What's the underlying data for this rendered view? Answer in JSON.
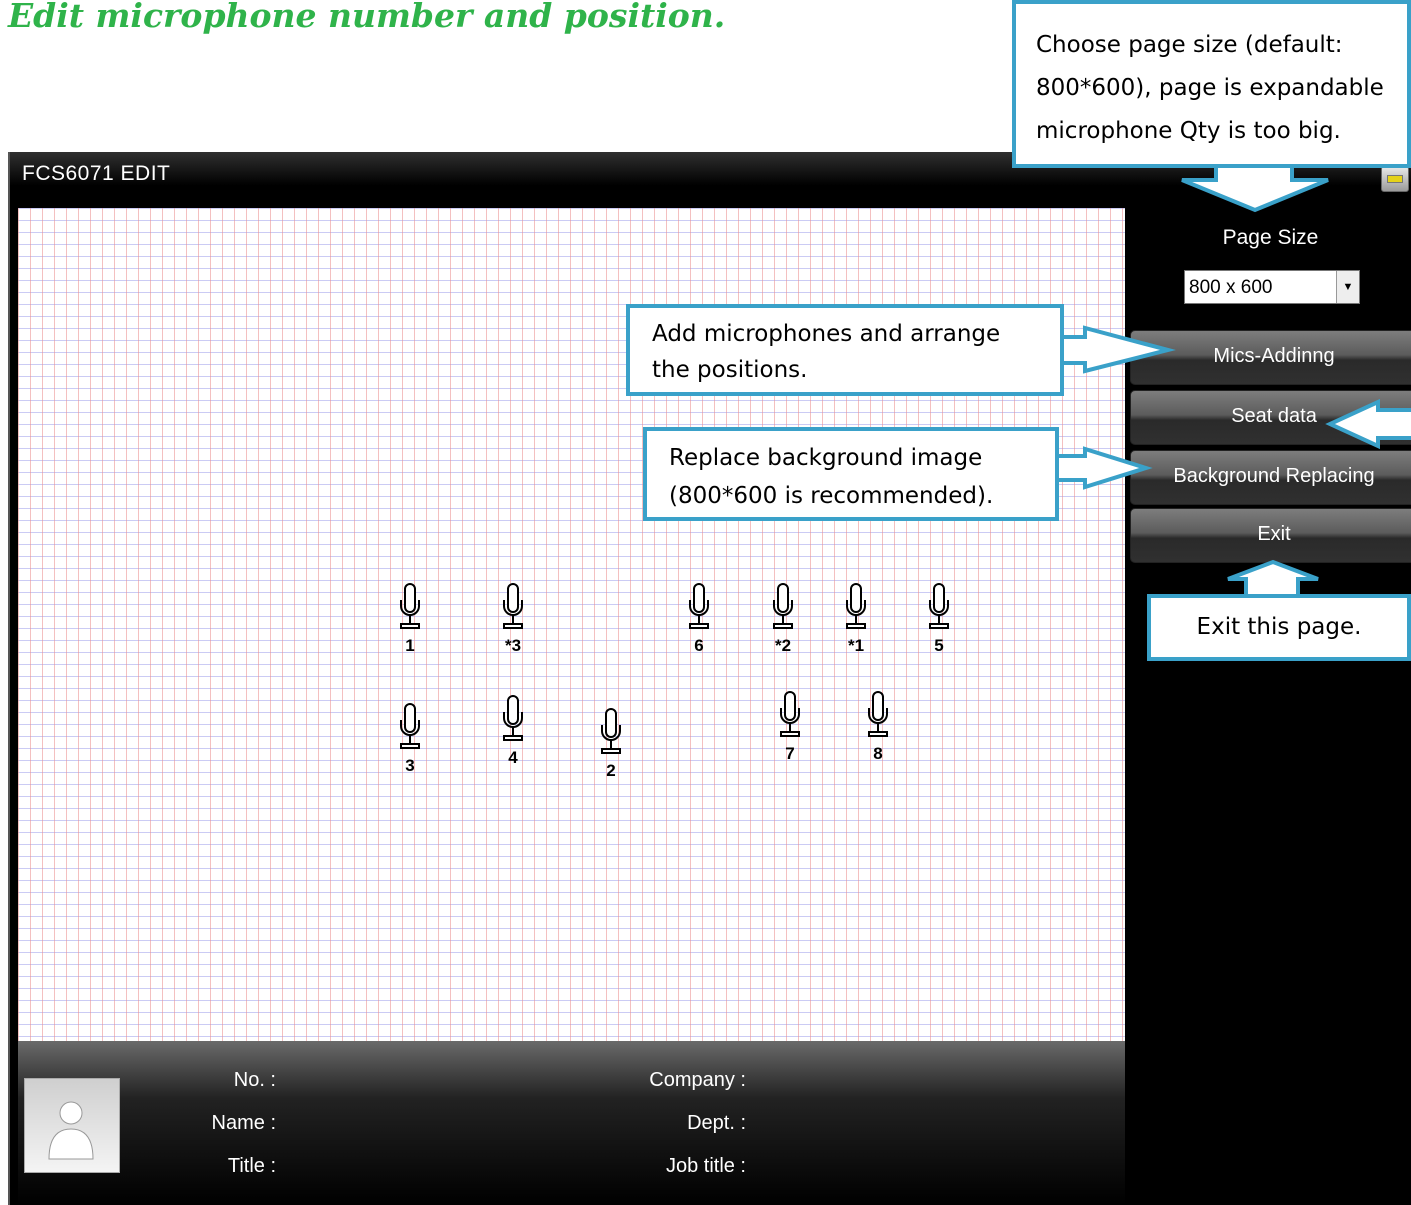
{
  "heading": "Edit microphone number and position.",
  "window": {
    "title": "FCS6071 EDIT",
    "minimize_icon": "minimize-icon"
  },
  "sidebar": {
    "page_size_label": "Page Size",
    "page_size_value": "800 x 600",
    "buttons": {
      "mics_adding": "Mics-Addinng",
      "seat_data": "Seat data",
      "background_replacing": "Background Replacing",
      "exit": "Exit"
    }
  },
  "microphones": [
    {
      "label": "1"
    },
    {
      "label": "*3"
    },
    {
      "label": "6"
    },
    {
      "label": "*2"
    },
    {
      "label": "*1"
    },
    {
      "label": "5"
    },
    {
      "label": "3"
    },
    {
      "label": "4"
    },
    {
      "label": "2"
    },
    {
      "label": "7"
    },
    {
      "label": "8"
    }
  ],
  "info": {
    "no": "No. :",
    "name": "Name :",
    "title": "Title :",
    "company": "Company :",
    "dept": "Dept. :",
    "job_title": "Job title :"
  },
  "callouts": {
    "page_size": [
      "Choose page size (default:",
      "800*600), page is expandable",
      "microphone Qty is too big."
    ],
    "add_mics": [
      "Add microphones and arrange",
      "the positions."
    ],
    "background": [
      "Replace background image",
      "(800*600 is recommended)."
    ],
    "exit": "Exit this page."
  },
  "colors": {
    "heading": "#2fb34a",
    "callout_border": "#3aa1c9"
  }
}
